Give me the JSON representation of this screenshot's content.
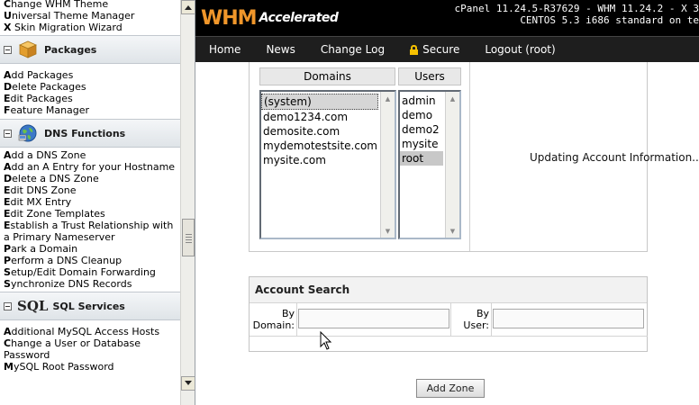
{
  "sidebar": {
    "top_links": [
      {
        "first": "C",
        "rest": "hange WHM Theme"
      },
      {
        "first": "U",
        "rest": "niversal Theme Manager"
      },
      {
        "first": "X",
        "rest": " Skin Migration Wizard"
      }
    ],
    "sections": [
      {
        "title": "Packages",
        "icon": "package-box-icon",
        "links": [
          {
            "first": "A",
            "rest": "dd Packages"
          },
          {
            "first": "D",
            "rest": "elete Packages"
          },
          {
            "first": "E",
            "rest": "dit Packages"
          },
          {
            "first": "F",
            "rest": "eature Manager"
          }
        ]
      },
      {
        "title": "DNS Functions",
        "icon": "globe-icon",
        "links": [
          {
            "first": "A",
            "rest": "dd a DNS Zone"
          },
          {
            "first": "A",
            "rest": "dd an A Entry for your Hostname"
          },
          {
            "first": "D",
            "rest": "elete a DNS Zone"
          },
          {
            "first": "E",
            "rest": "dit DNS Zone"
          },
          {
            "first": "E",
            "rest": "dit MX Entry"
          },
          {
            "first": "E",
            "rest": "dit Zone Templates"
          },
          {
            "first": "E",
            "rest": "stablish a Trust Relationship with a Primary Nameserver"
          },
          {
            "first": "P",
            "rest": "ark a Domain"
          },
          {
            "first": "P",
            "rest": "erform a DNS Cleanup"
          },
          {
            "first": "S",
            "rest": "etup/Edit Domain Forwarding"
          },
          {
            "first": "S",
            "rest": "ynchronize DNS Records"
          }
        ]
      },
      {
        "title": "SQL Services",
        "icon_text": "SQL",
        "icon": "sql-icon",
        "links": [
          {
            "first": "A",
            "rest": "dditional MySQL Access Hosts"
          },
          {
            "first": "C",
            "rest": "hange a User or Database Password"
          },
          {
            "first": "M",
            "rest": "ySQL Root Password"
          }
        ]
      }
    ]
  },
  "header": {
    "logo_brand": "WHM",
    "logo_suffix": "Accelerated",
    "version_line1": "cPanel 11.24.5-R37629 - WHM 11.24.2 - X 3",
    "version_line2": "CENTOS 5.3 i686 standard on te"
  },
  "nav": {
    "items": [
      "Home",
      "News",
      "Change Log",
      "Secure",
      "Logout (root)"
    ]
  },
  "accounts": {
    "domains_header": "Domains",
    "users_header": "Users",
    "domains": [
      "(system)",
      "demo1234.com",
      "demosite.com",
      "mydemotestsite.com",
      "mysite.com"
    ],
    "users": [
      "admin",
      "demo",
      "demo2",
      "mysite",
      "root"
    ],
    "selected_domain": "(system)",
    "selected_user": "root",
    "status": "Updating Account Information..."
  },
  "search": {
    "title": "Account Search",
    "by_domain_label_1": "By",
    "by_domain_label_2": "Domain:",
    "by_user_label_1": "By",
    "by_user_label_2": "User:",
    "domain_value": "",
    "user_value": ""
  },
  "actions": {
    "add_zone": "Add Zone"
  },
  "colors": {
    "brand_orange": "#f0962a",
    "header_bg": "#000000",
    "nav_bg": "#1e1e1e",
    "lock_yellow": "#f5c000"
  }
}
